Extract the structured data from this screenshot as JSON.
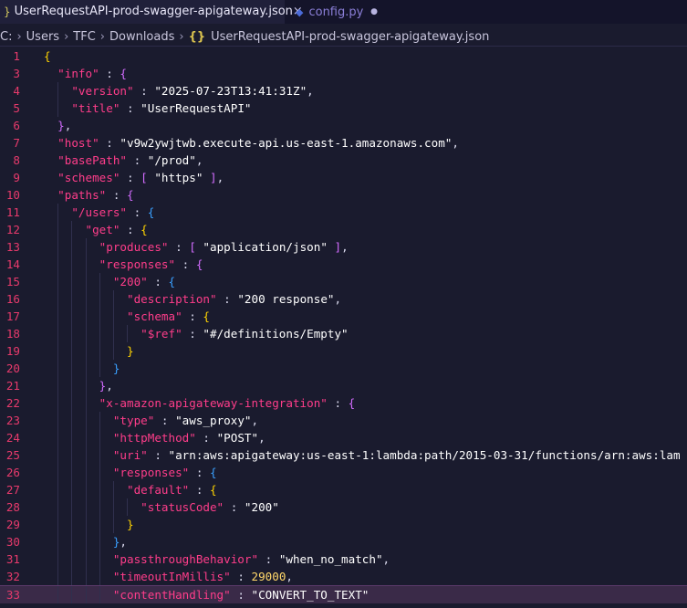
{
  "tabs": [
    {
      "label": "UserRequestAPI-prod-swagger-apigateway.json",
      "active": true
    },
    {
      "label": "config.py",
      "active": false,
      "dirty": true
    }
  ],
  "breadcrumb": [
    "C:",
    "Users",
    "TFC",
    "Downloads",
    "UserRequestAPI-prod-swagger-apigateway.json"
  ],
  "editor": {
    "current_line": 33,
    "lines": [
      {
        "n": "1",
        "tokens": [
          [
            "b1",
            "{"
          ]
        ]
      },
      {
        "n": "3",
        "tokens": [
          [
            "s",
            "  "
          ],
          [
            "k",
            "\"info\""
          ],
          [
            "p",
            " : "
          ],
          [
            "b2",
            "{"
          ]
        ]
      },
      {
        "n": "4",
        "tokens": [
          [
            "s",
            "    "
          ],
          [
            "k",
            "\"version\""
          ],
          [
            "p",
            " : "
          ],
          [
            "s",
            "\"2025-07-23T13:41:31Z\""
          ],
          [
            "p",
            ","
          ]
        ]
      },
      {
        "n": "5",
        "tokens": [
          [
            "s",
            "    "
          ],
          [
            "k",
            "\"title\""
          ],
          [
            "p",
            " : "
          ],
          [
            "s",
            "\"UserRequestAPI\""
          ]
        ]
      },
      {
        "n": "6",
        "tokens": [
          [
            "s",
            "  "
          ],
          [
            "b2",
            "}"
          ],
          [
            "p",
            ","
          ]
        ]
      },
      {
        "n": "7",
        "tokens": [
          [
            "s",
            "  "
          ],
          [
            "k",
            "\"host\""
          ],
          [
            "p",
            " : "
          ],
          [
            "s",
            "\"v9w2ywjtwb.execute-api.us-east-1.amazonaws.com\""
          ],
          [
            "p",
            ","
          ]
        ]
      },
      {
        "n": "8",
        "tokens": [
          [
            "s",
            "  "
          ],
          [
            "k",
            "\"basePath\""
          ],
          [
            "p",
            " : "
          ],
          [
            "s",
            "\"/prod\""
          ],
          [
            "p",
            ","
          ]
        ]
      },
      {
        "n": "9",
        "tokens": [
          [
            "s",
            "  "
          ],
          [
            "k",
            "\"schemes\""
          ],
          [
            "p",
            " : "
          ],
          [
            "b2",
            "["
          ],
          [
            "s",
            " \"https\" "
          ],
          [
            "b2",
            "]"
          ],
          [
            "p",
            ","
          ]
        ]
      },
      {
        "n": "10",
        "tokens": [
          [
            "s",
            "  "
          ],
          [
            "k",
            "\"paths\""
          ],
          [
            "p",
            " : "
          ],
          [
            "b2",
            "{"
          ]
        ]
      },
      {
        "n": "11",
        "tokens": [
          [
            "s",
            "    "
          ],
          [
            "k",
            "\"/users\""
          ],
          [
            "p",
            " : "
          ],
          [
            "b3",
            "{"
          ]
        ]
      },
      {
        "n": "12",
        "tokens": [
          [
            "s",
            "      "
          ],
          [
            "k",
            "\"get\""
          ],
          [
            "p",
            " : "
          ],
          [
            "b1",
            "{"
          ]
        ]
      },
      {
        "n": "13",
        "tokens": [
          [
            "s",
            "        "
          ],
          [
            "k",
            "\"produces\""
          ],
          [
            "p",
            " : "
          ],
          [
            "b2",
            "["
          ],
          [
            "s",
            " \"application/json\" "
          ],
          [
            "b2",
            "]"
          ],
          [
            "p",
            ","
          ]
        ]
      },
      {
        "n": "14",
        "tokens": [
          [
            "s",
            "        "
          ],
          [
            "k",
            "\"responses\""
          ],
          [
            "p",
            " : "
          ],
          [
            "b2",
            "{"
          ]
        ]
      },
      {
        "n": "15",
        "tokens": [
          [
            "s",
            "          "
          ],
          [
            "k",
            "\"200\""
          ],
          [
            "p",
            " : "
          ],
          [
            "b3",
            "{"
          ]
        ]
      },
      {
        "n": "16",
        "tokens": [
          [
            "s",
            "            "
          ],
          [
            "k",
            "\"description\""
          ],
          [
            "p",
            " : "
          ],
          [
            "s",
            "\"200 response\""
          ],
          [
            "p",
            ","
          ]
        ]
      },
      {
        "n": "17",
        "tokens": [
          [
            "s",
            "            "
          ],
          [
            "k",
            "\"schema\""
          ],
          [
            "p",
            " : "
          ],
          [
            "b1",
            "{"
          ]
        ]
      },
      {
        "n": "18",
        "tokens": [
          [
            "s",
            "              "
          ],
          [
            "k",
            "\"$ref\""
          ],
          [
            "p",
            " : "
          ],
          [
            "s",
            "\"#/definitions/Empty\""
          ]
        ]
      },
      {
        "n": "19",
        "tokens": [
          [
            "s",
            "            "
          ],
          [
            "b1",
            "}"
          ]
        ]
      },
      {
        "n": "20",
        "tokens": [
          [
            "s",
            "          "
          ],
          [
            "b3",
            "}"
          ]
        ]
      },
      {
        "n": "21",
        "tokens": [
          [
            "s",
            "        "
          ],
          [
            "b2",
            "}"
          ],
          [
            "p",
            ","
          ]
        ]
      },
      {
        "n": "22",
        "tokens": [
          [
            "s",
            "        "
          ],
          [
            "k",
            "\"x-amazon-apigateway-integration\""
          ],
          [
            "p",
            " : "
          ],
          [
            "b2",
            "{"
          ]
        ]
      },
      {
        "n": "23",
        "tokens": [
          [
            "s",
            "          "
          ],
          [
            "k",
            "\"type\""
          ],
          [
            "p",
            " : "
          ],
          [
            "s",
            "\"aws_proxy\""
          ],
          [
            "p",
            ","
          ]
        ]
      },
      {
        "n": "24",
        "tokens": [
          [
            "s",
            "          "
          ],
          [
            "k",
            "\"httpMethod\""
          ],
          [
            "p",
            " : "
          ],
          [
            "s",
            "\"POST\""
          ],
          [
            "p",
            ","
          ]
        ]
      },
      {
        "n": "25",
        "tokens": [
          [
            "s",
            "          "
          ],
          [
            "k",
            "\"uri\""
          ],
          [
            "p",
            " : "
          ],
          [
            "s",
            "\"arn:aws:apigateway:us-east-1:lambda:path/2015-03-31/functions/arn:aws:lam"
          ]
        ]
      },
      {
        "n": "26",
        "tokens": [
          [
            "s",
            "          "
          ],
          [
            "k",
            "\"responses\""
          ],
          [
            "p",
            " : "
          ],
          [
            "b3",
            "{"
          ]
        ]
      },
      {
        "n": "27",
        "tokens": [
          [
            "s",
            "            "
          ],
          [
            "k",
            "\"default\""
          ],
          [
            "p",
            " : "
          ],
          [
            "b1",
            "{"
          ]
        ]
      },
      {
        "n": "28",
        "tokens": [
          [
            "s",
            "              "
          ],
          [
            "k",
            "\"statusCode\""
          ],
          [
            "p",
            " : "
          ],
          [
            "s",
            "\"200\""
          ]
        ]
      },
      {
        "n": "29",
        "tokens": [
          [
            "s",
            "            "
          ],
          [
            "b1",
            "}"
          ]
        ]
      },
      {
        "n": "30",
        "tokens": [
          [
            "s",
            "          "
          ],
          [
            "b3",
            "}"
          ],
          [
            "p",
            ","
          ]
        ]
      },
      {
        "n": "31",
        "tokens": [
          [
            "s",
            "          "
          ],
          [
            "k",
            "\"passthroughBehavior\""
          ],
          [
            "p",
            " : "
          ],
          [
            "s",
            "\"when_no_match\""
          ],
          [
            "p",
            ","
          ]
        ]
      },
      {
        "n": "32",
        "tokens": [
          [
            "s",
            "          "
          ],
          [
            "k",
            "\"timeoutInMillis\""
          ],
          [
            "p",
            " : "
          ],
          [
            "n",
            "29000"
          ],
          [
            "p",
            ","
          ]
        ]
      },
      {
        "n": "33",
        "tokens": [
          [
            "s",
            "          "
          ],
          [
            "k",
            "\"contentHandling\""
          ],
          [
            "p",
            " : "
          ],
          [
            "s",
            "\"CONVERT_TO_TEXT\""
          ]
        ]
      }
    ]
  }
}
